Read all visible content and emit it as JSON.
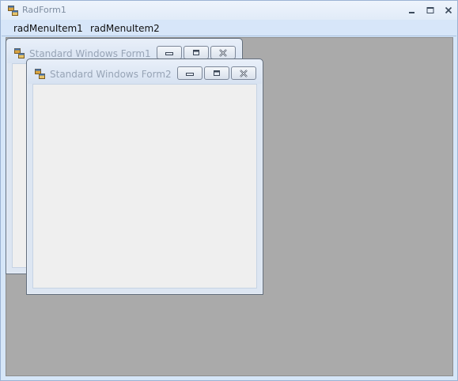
{
  "main_window": {
    "title": "RadForm1",
    "icon": "app-form-icon",
    "controls": [
      "minimize-icon",
      "maximize-icon",
      "close-icon"
    ]
  },
  "menu": {
    "items": [
      {
        "label": "radMenuItem1"
      },
      {
        "label": "radMenuItem2"
      }
    ]
  },
  "mdi_children": [
    {
      "title": "Standard Windows Form1",
      "icon": "app-form-icon",
      "buttons": [
        "minimize-icon",
        "restore-icon",
        "close-icon"
      ]
    },
    {
      "title": "Standard Windows Form2",
      "icon": "app-form-icon",
      "buttons": [
        "minimize-icon",
        "restore-icon",
        "close-icon"
      ]
    }
  ],
  "colors": {
    "mdi_background": "#aaaaaa",
    "menubar_background": "#d7e6f9",
    "client_background": "#efefef",
    "title_text": "#97a4b6"
  }
}
